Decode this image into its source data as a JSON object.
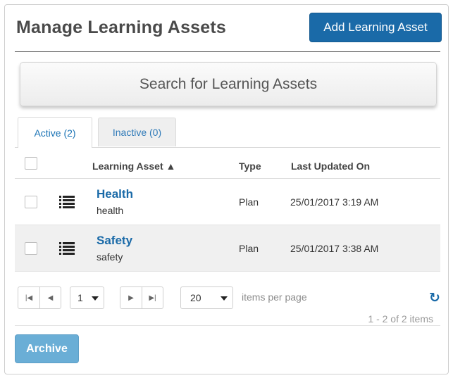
{
  "header": {
    "title": "Manage Learning Assets",
    "add_button_label": "Add Learning Asset"
  },
  "search": {
    "button_label": "Search for Learning Assets"
  },
  "tabs": [
    {
      "label": "Active (2)",
      "selected": true
    },
    {
      "label": "Inactive (0)",
      "selected": false
    }
  ],
  "grid": {
    "columns": {
      "asset": "Learning Asset ▲",
      "type": "Type",
      "updated": "Last Updated On"
    },
    "rows": [
      {
        "name": "Health",
        "subtitle": "health",
        "type": "Plan",
        "updated": "25/01/2017 3:19 AM"
      },
      {
        "name": "Safety",
        "subtitle": "safety",
        "type": "Plan",
        "updated": "25/01/2017 3:38 AM"
      }
    ]
  },
  "pager": {
    "current_page": "1",
    "page_size": "20",
    "items_per_page_label": "items per page",
    "range_text": "1 - 2 of 2 items",
    "refresh_icon": "↻"
  },
  "footer": {
    "archive_label": "Archive"
  },
  "colors": {
    "primary": "#1a6aa8",
    "archive_disabled": "#6aaed6",
    "link": "#1a6aa8"
  }
}
